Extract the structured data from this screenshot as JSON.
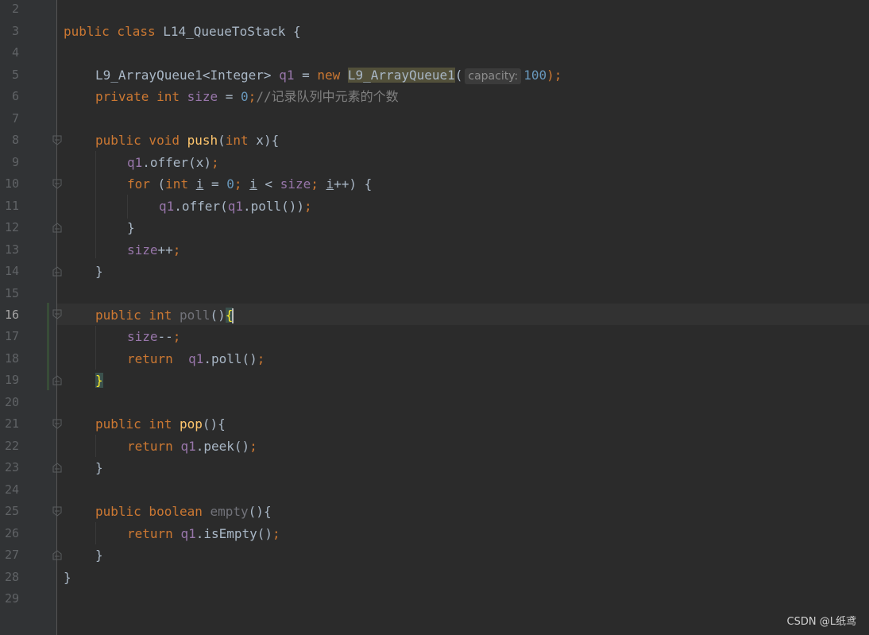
{
  "line_numbers": [
    "2",
    "3",
    "4",
    "5",
    "6",
    "7",
    "8",
    "9",
    "10",
    "11",
    "12",
    "13",
    "14",
    "15",
    "16",
    "17",
    "18",
    "19",
    "20",
    "21",
    "22",
    "23",
    "24",
    "25",
    "26",
    "27",
    "28",
    "29"
  ],
  "current_line": "16",
  "code": {
    "l3": {
      "kw": "public class ",
      "name": "L14_QueueToStack",
      "rest": " {"
    },
    "l5": {
      "type": "L9_ArrayQueue1<Integer> ",
      "field": "q1",
      "eq": " = ",
      "new": "new ",
      "ctor": "L9_ArrayQueue1",
      "paren": "(",
      "hint": "capacity:",
      "num": "100",
      "end": ");"
    },
    "l6": {
      "kw": "private int ",
      "field": "size",
      "eq": " = ",
      "num": "0",
      "semi": ";",
      "comment": "//",
      "comment_cjk": "记录队列中元素的个数"
    },
    "l8": {
      "kw": "public void ",
      "fn": "push",
      "open": "(",
      "kw2": "int",
      "rest": " x){"
    },
    "l9": {
      "field": "q1",
      "rest": ".offer(x)",
      "semi": ";"
    },
    "l10": {
      "kw": "for ",
      "p1": "(",
      "kw2": "int ",
      "i1": "i",
      "p2": " = ",
      "num": "0",
      "semi1": "; ",
      "i2": "i",
      "p3": " < ",
      "field": "size",
      "semi2": "; ",
      "i3": "i",
      "p4": "++) {"
    },
    "l11": {
      "field1": "q1",
      "p1": ".offer(",
      "field2": "q1",
      "p2": ".poll())",
      "semi": ";"
    },
    "l12": {
      "text": "}"
    },
    "l13": {
      "field": "size",
      "rest": "++",
      "semi": ";"
    },
    "l14": {
      "text": "}"
    },
    "l16": {
      "kw": "public int ",
      "fn": "poll",
      "paren": "()",
      "brace": "{"
    },
    "l17": {
      "field": "size",
      "rest": "--",
      "semi": ";"
    },
    "l18": {
      "kw": "return  ",
      "field": "q1",
      "rest": ".poll()",
      "semi": ";"
    },
    "l19": {
      "brace": "}"
    },
    "l21": {
      "kw": "public int ",
      "fn": "pop",
      "rest": "(){"
    },
    "l22": {
      "kw": "return ",
      "field": "q1",
      "rest": ".peek()",
      "semi": ";"
    },
    "l23": {
      "text": "}"
    },
    "l25": {
      "kw": "public boolean ",
      "fn": "empty",
      "rest": "(){"
    },
    "l26": {
      "kw": "return ",
      "field": "q1",
      "rest": ".isEmpty()",
      "semi": ";"
    },
    "l27": {
      "text": "}"
    },
    "l28": {
      "text": "}"
    }
  },
  "watermark": "CSDN @L纸鸢",
  "colors": {
    "background": "#2b2b2b",
    "keyword": "#cc7832",
    "function": "#ffc66d",
    "field": "#9876aa",
    "number": "#6897bb",
    "comment": "#808080",
    "text": "#a9b7c6"
  }
}
